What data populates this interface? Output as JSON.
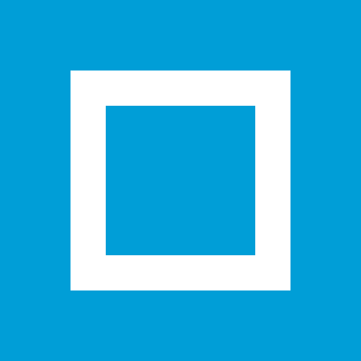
{
  "icon": {
    "name": "square-outline-icon",
    "background_color": "#009ED7",
    "foreground_color": "#FFFFFF"
  }
}
